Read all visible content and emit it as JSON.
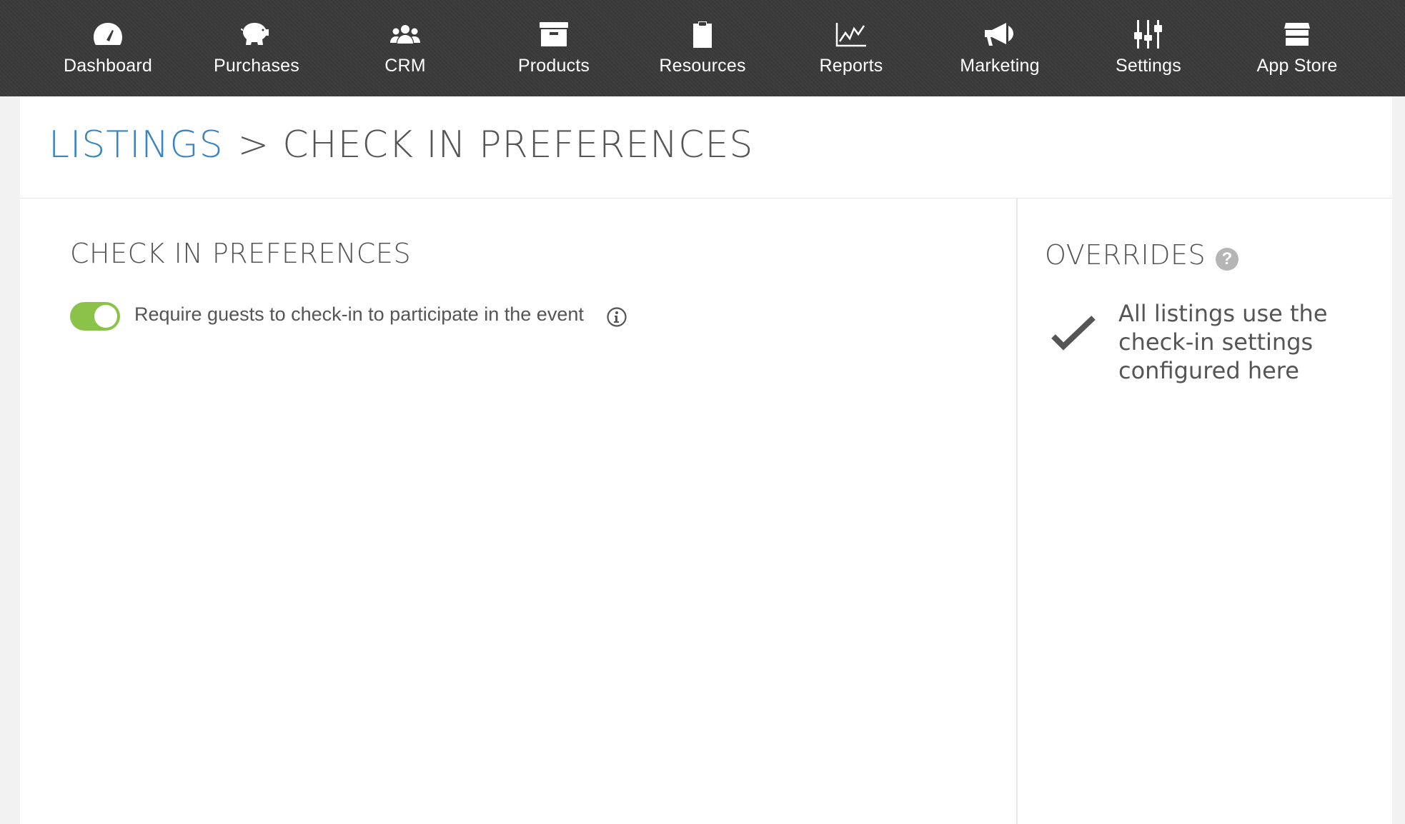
{
  "nav": {
    "items": [
      {
        "label": "Dashboard",
        "icon": "dashboard-gauge-icon"
      },
      {
        "label": "Purchases",
        "icon": "piggy-bank-icon"
      },
      {
        "label": "CRM",
        "icon": "users-group-icon"
      },
      {
        "label": "Products",
        "icon": "archive-box-icon"
      },
      {
        "label": "Resources",
        "icon": "clipboard-icon"
      },
      {
        "label": "Reports",
        "icon": "line-chart-icon"
      },
      {
        "label": "Marketing",
        "icon": "megaphone-icon"
      },
      {
        "label": "Settings",
        "icon": "sliders-icon"
      },
      {
        "label": "App Store",
        "icon": "storefront-icon"
      }
    ]
  },
  "breadcrumb": {
    "parent": "LISTINGS",
    "separator": ">",
    "current": "CHECK IN PREFERENCES"
  },
  "preferences": {
    "title": "CHECK IN PREFERENCES",
    "toggle_label": "Require guests to check-in to participate in the event",
    "toggle_on": true
  },
  "overrides": {
    "title": "OVERRIDES",
    "help": "?",
    "text": "All listings use the check-in settings configured here"
  },
  "colors": {
    "nav_bg": "#3a3a3a",
    "link": "#3a84c0",
    "toggle_on": "#8bc34a",
    "text": "#555555"
  }
}
